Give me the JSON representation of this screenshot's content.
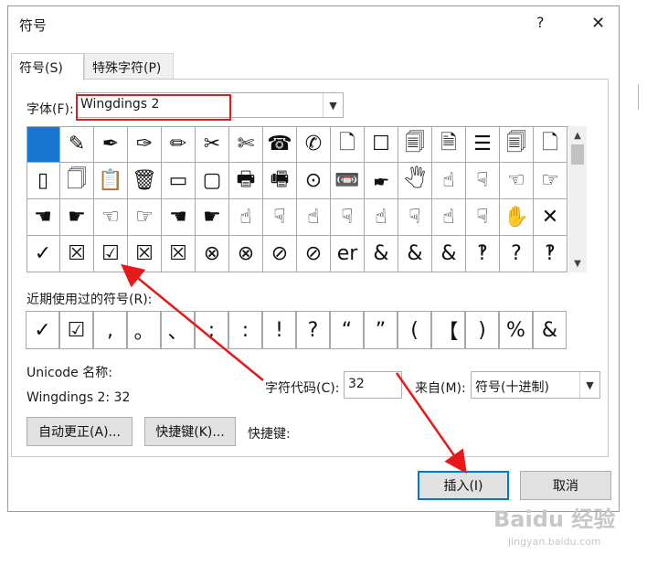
{
  "window": {
    "title": "符号",
    "help": "?",
    "close": "✕"
  },
  "tabs": [
    {
      "label": "符号(S)"
    },
    {
      "label": "特殊字符(P)"
    }
  ],
  "font": {
    "label": "字体(F):",
    "value": "Wingdings 2"
  },
  "grid": {
    "rows": [
      [
        "",
        "✎",
        "✒",
        "✑",
        "✏",
        "✂",
        "✄",
        "☎",
        "✆",
        "🗋",
        "☐",
        "🗐",
        "🗎",
        "☰",
        "🗐",
        "🗋"
      ],
      [
        "▯",
        "🗍",
        "📋",
        "🗑",
        "▭",
        "▢",
        "🖶",
        "🖷",
        "⊙",
        "📼",
        "🖝",
        "🖑",
        "☝",
        "☟",
        "☜",
        "☞"
      ],
      [
        "☚",
        "☛",
        "☜",
        "☞",
        "☚",
        "☛",
        "☝",
        "☟",
        "☝",
        "☟",
        "☝",
        "☟",
        "☝",
        "☟",
        "✋",
        "✕"
      ],
      [
        "✓",
        "☒",
        "☑",
        "☒",
        "☒",
        "⊗",
        "⊗",
        "⊘",
        "⊘",
        "er",
        "&",
        "&",
        "&",
        "‽",
        "?",
        "‽"
      ]
    ]
  },
  "recent": {
    "label": "近期使用过的符号(R):",
    "symbols": [
      "✓",
      "☑",
      ",",
      "。",
      "、",
      ";",
      ":",
      "!",
      "?",
      "“",
      "”",
      "(",
      "【",
      ")",
      "%",
      "&"
    ]
  },
  "unicode_name": {
    "label": "Unicode 名称:",
    "value": "Wingdings 2: 32"
  },
  "char_code": {
    "label": "字符代码(C):",
    "value": "32"
  },
  "from": {
    "label": "来自(M):",
    "value": "符号(十进制)"
  },
  "buttons": {
    "autocorrect": "自动更正(A)...",
    "shortcut_key": "快捷键(K)...",
    "shortcut_label": "快捷键:",
    "insert": "插入(I)",
    "cancel": "取消"
  },
  "watermark": {
    "main": "Baidu 经验",
    "sub": "jingyan.baidu.com"
  },
  "colors": {
    "selection": "#1976d2",
    "annotation": "#e8191b",
    "insert_border": "#0078d7"
  }
}
